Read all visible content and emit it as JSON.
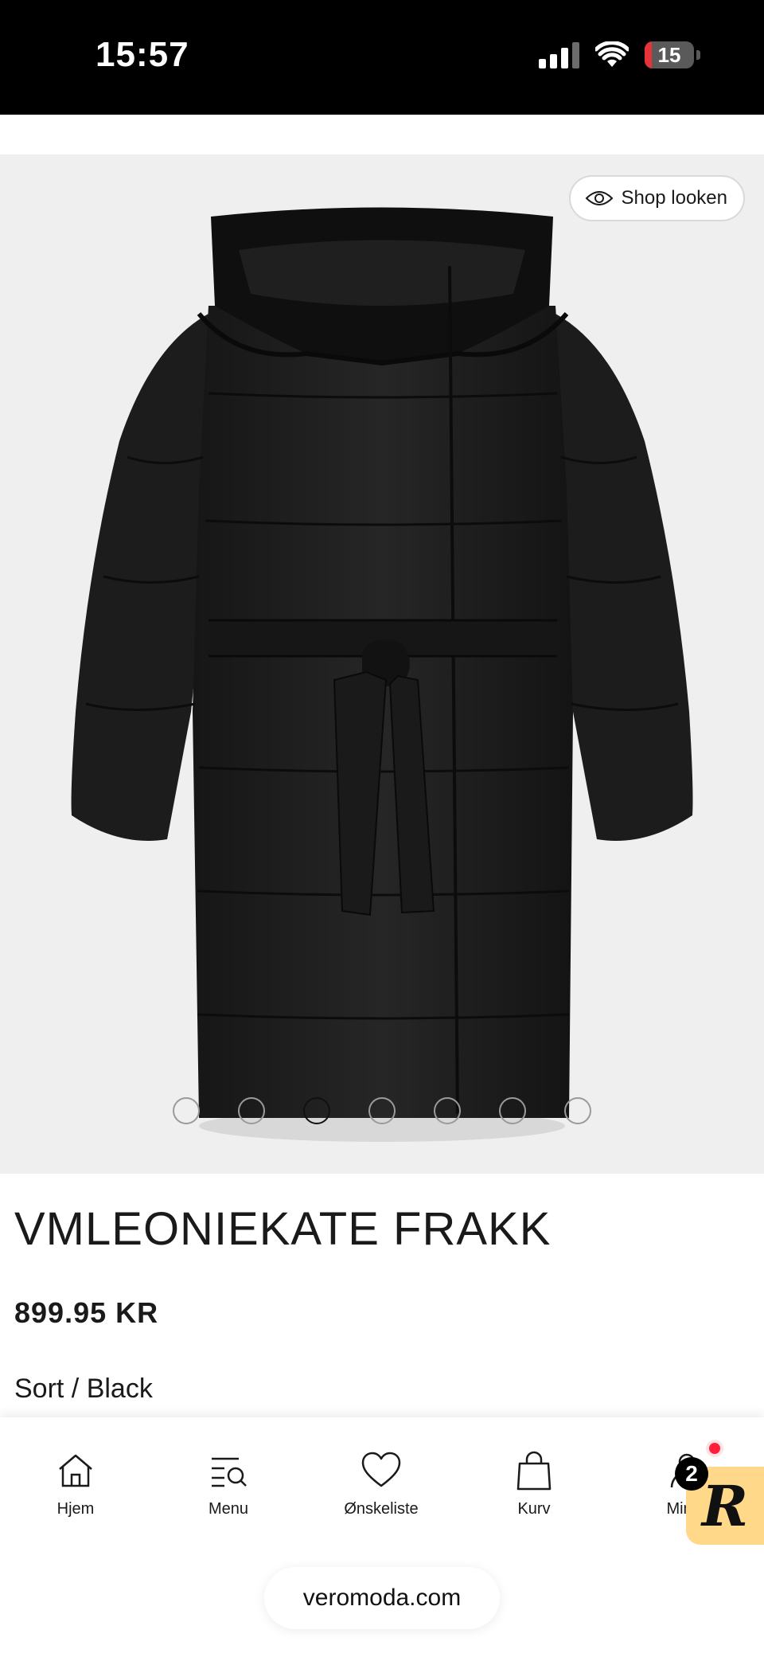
{
  "status_bar": {
    "time": "15:57",
    "battery_level": "15",
    "battery_fraction": 0.15,
    "battery_color": "#e5333a"
  },
  "gallery": {
    "shop_look_label": "Shop looken",
    "dot_count": 7,
    "active_dot_index": 2
  },
  "product": {
    "title": "VMLEONIEKATE FRAKK",
    "price": "899.95 KR",
    "color": "Sort / Black"
  },
  "bottom_nav": {
    "items": [
      {
        "label": "Hjem",
        "icon": "home-icon"
      },
      {
        "label": "Menu",
        "icon": "menu-search-icon"
      },
      {
        "label": "Ønskeliste",
        "icon": "heart-icon"
      },
      {
        "label": "Kurv",
        "icon": "bag-icon"
      },
      {
        "label": "Min K",
        "icon": "account-icon"
      }
    ]
  },
  "rewards": {
    "letter": "R",
    "count": "2",
    "background": "#ffd88a"
  },
  "browser": {
    "url": "veromoda.com"
  }
}
